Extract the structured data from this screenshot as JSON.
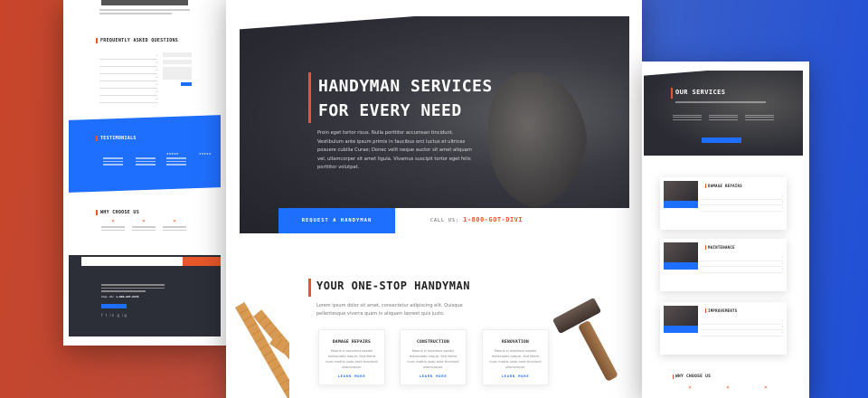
{
  "left": {
    "faq_title": "FREQUENTLY ASKED QUESTIONS",
    "faq_items": [
      "",
      "",
      "",
      "",
      "",
      "",
      ""
    ],
    "testimonials_title": "TESTIMONIALS",
    "stars": "★★★★★",
    "why_title": "WHY CHOOSE US",
    "footer": {
      "call_label": "CALL US:",
      "call_number": "1-800-GOT-DIVI",
      "social": "f t in g ig"
    }
  },
  "center": {
    "hero": {
      "title_line1": "HANDYMAN SERVICES",
      "title_line2": "FOR EVERY NEED",
      "body": "Proin eget tortor risus. Nulla porttitor accumsan tincidunt. Vestibulum ante ipsum primis in faucibus orci luctus et ultrices posuere cubilia Curae; Donec velit neque auctor sit amet aliquam vel, ullamcorper sit amet ligula. Vivamus suscipit tortor eget felis porttitor volutpat.",
      "cta_label": "REQUEST A HANDYMAN",
      "call_label": "CALL US:",
      "call_number": "1-800-GOT-DIVI"
    },
    "section": {
      "title": "YOUR ONE-STOP HANDYMAN",
      "body": "Lorem ipsum dolor sit amet, consectetur adipiscing elit. Quisque pellentesque viverra quam in aliquam laoreet quis justo."
    },
    "cards": [
      {
        "title": "DAMAGE REPAIRS",
        "body": "Mauris si maximus sapien malesuada neque. Sed libero nunc mattis justo ante tincidunt ullamcorper.",
        "link": "LEARN MORE"
      },
      {
        "title": "CONSTRUCTION",
        "body": "Mauris si maximus sapien malesuada neque. Sed libero nunc mattis justo ante tincidunt ullamcorper.",
        "link": "LEARN MORE"
      },
      {
        "title": "RENOVATION",
        "body": "Mauris si maximus sapien malesuada neque. Sed libero nunc mattis justo ante tincidunt ullamcorper.",
        "link": "LEARN MORE"
      }
    ]
  },
  "right": {
    "hero_title": "OUR SERVICES",
    "cards": [
      {
        "title": "DAMAGE REPAIRS"
      },
      {
        "title": "MAINTENANCE"
      },
      {
        "title": "IMPROVEMENTS"
      }
    ],
    "why_title": "WHY CHOOSE US"
  },
  "colors": {
    "accent_orange": "#e8572a",
    "primary_blue": "#1f6fff",
    "dark": "#2a2b33"
  }
}
